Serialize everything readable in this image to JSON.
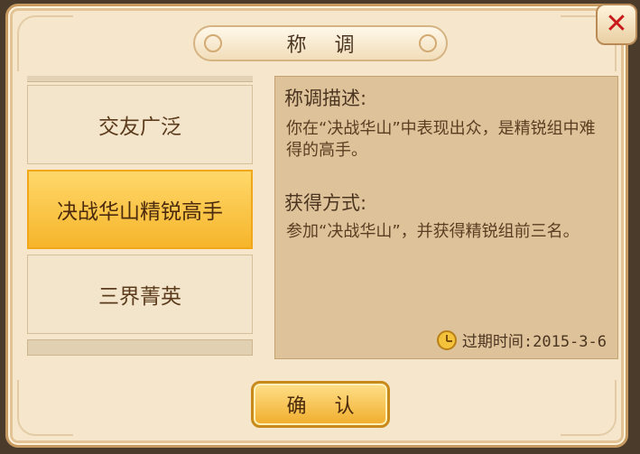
{
  "dialog": {
    "title": "称 调",
    "close_icon": "close-icon",
    "accent_color": "#f6b52b",
    "close_color": "#c8191b"
  },
  "titles": [
    {
      "label": "交友广泛",
      "selected": false
    },
    {
      "label": "决战华山精锐高手",
      "selected": true
    },
    {
      "label": "三界菁英",
      "selected": false
    }
  ],
  "description": {
    "heading": "称调描述:",
    "text": "你在“决战华山”中表现出众，是精锐组中难得的高手。",
    "obtain_heading": "获得方式:",
    "obtain_text": "参加“决战华山”，并获得精锐组前三名。",
    "expiry_icon": "clock-icon",
    "expiry_label": "过期时间:2015-3-6"
  },
  "confirm_button": {
    "label": "确 认"
  }
}
